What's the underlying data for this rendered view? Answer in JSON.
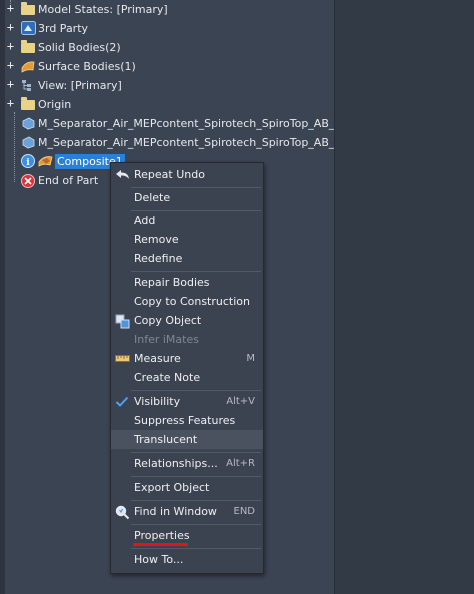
{
  "tree": {
    "items": [
      {
        "label": "Model States: [Primary]",
        "icon": "folder-icon",
        "expander": "+"
      },
      {
        "label": "3rd Party",
        "icon": "third-party-icon",
        "expander": "+"
      },
      {
        "label": "Solid Bodies(2)",
        "icon": "folder-icon",
        "expander": "+"
      },
      {
        "label": "Surface Bodies(1)",
        "icon": "surface-bodies-icon",
        "expander": "+"
      },
      {
        "label": "View: [Primary]",
        "icon": "view-icon",
        "expander": "+"
      },
      {
        "label": "Origin",
        "icon": "folder-icon",
        "expander": "+"
      },
      {
        "label": "M_Separator_Air_MEPcontent_Spirotech_SpiroTop_AB_INT-EN-",
        "icon": "part-icon",
        "expander": ""
      },
      {
        "label": "M_Separator_Air_MEPcontent_Spirotech_SpiroTop_AB_INT-EN-",
        "icon": "part-icon",
        "expander": ""
      },
      {
        "label": "Composite1",
        "icon": "composite-icon",
        "expander": ""
      },
      {
        "label": "End of Part",
        "icon": "end-of-part-icon",
        "expander": ""
      }
    ]
  },
  "context_menu": {
    "items": [
      {
        "label": "Repeat Undo",
        "shortcut": "",
        "icon": "undo-arrow-icon",
        "disabled": false
      },
      {
        "label": "Delete",
        "shortcut": "",
        "icon": "",
        "disabled": false
      },
      {
        "label": "Add",
        "shortcut": "",
        "icon": "",
        "disabled": false
      },
      {
        "label": "Remove",
        "shortcut": "",
        "icon": "",
        "disabled": false
      },
      {
        "label": "Redefine",
        "shortcut": "",
        "icon": "",
        "disabled": false
      },
      {
        "label": "Repair Bodies",
        "shortcut": "",
        "icon": "",
        "disabled": false
      },
      {
        "label": "Copy to Construction",
        "shortcut": "",
        "icon": "",
        "disabled": false
      },
      {
        "label": "Copy Object",
        "shortcut": "",
        "icon": "copy-object-icon",
        "disabled": false
      },
      {
        "label": "Infer iMates",
        "shortcut": "",
        "icon": "",
        "disabled": true
      },
      {
        "label": "Measure",
        "shortcut": "M",
        "icon": "ruler-icon",
        "disabled": false
      },
      {
        "label": "Create Note",
        "shortcut": "",
        "icon": "",
        "disabled": false
      },
      {
        "label": "Visibility",
        "shortcut": "Alt+V",
        "icon": "checkmark-icon",
        "disabled": false
      },
      {
        "label": "Suppress Features",
        "shortcut": "",
        "icon": "",
        "disabled": false
      },
      {
        "label": "Translucent",
        "shortcut": "",
        "icon": "",
        "disabled": false
      },
      {
        "label": "Relationships...",
        "shortcut": "Alt+R",
        "icon": "",
        "disabled": false
      },
      {
        "label": "Export Object",
        "shortcut": "",
        "icon": "",
        "disabled": false
      },
      {
        "label": "Find in Window",
        "shortcut": "END",
        "icon": "find-zoom-icon",
        "disabled": false
      },
      {
        "label": "Properties",
        "shortcut": "",
        "icon": "",
        "disabled": false
      },
      {
        "label": "How To...",
        "shortcut": "",
        "icon": "",
        "disabled": false
      }
    ]
  },
  "colors": {
    "selection": "#2b7fd6",
    "annotation_underline": "#e0141b",
    "check": "#4aa3f0"
  }
}
